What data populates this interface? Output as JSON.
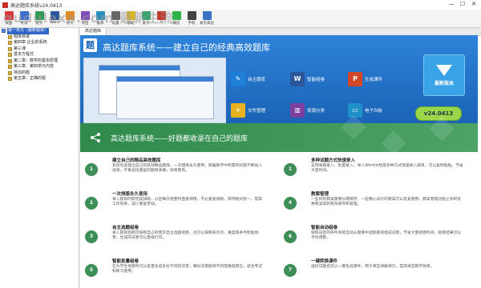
{
  "window": {
    "title": "高达题库系统v24.0413",
    "watermark": "qudulexa.com 最新主流"
  },
  "toolbar": [
    {
      "label": "试卷",
      "icon": "exam-icon",
      "color": "#d83b3b"
    },
    {
      "label": "考试",
      "icon": "test-icon",
      "color": "#3a6fcf"
    },
    {
      "label": "统计",
      "icon": "stats-icon",
      "color": "#2f9a53"
    },
    {
      "label": "Word",
      "icon": "word-icon",
      "color": "#2b579a"
    },
    {
      "label": "导入",
      "icon": "import-icon",
      "color": "#e08a1f"
    },
    {
      "label": "导出",
      "icon": "export-icon",
      "color": "#7d4bb8"
    },
    {
      "label": "备份",
      "icon": "backup-icon",
      "color": "#2a8fbf"
    },
    {
      "label": "设置",
      "icon": "settings-icon",
      "color": "#666666"
    },
    {
      "label": "帮助",
      "icon": "help-icon",
      "color": "#e0b81f"
    },
    {
      "label": "关于",
      "icon": "about-icon",
      "color": "#3aa26a"
    },
    {
      "label": "A",
      "icon": "font-icon",
      "color": "#c0392b"
    },
    {
      "label": "微信",
      "icon": "wechat-icon",
      "color": "#2fb34a"
    },
    {
      "label": "手机",
      "icon": "phone-icon",
      "color": "#444444"
    },
    {
      "label": "关于高达",
      "icon": "info-icon",
      "color": "#3b73c4"
    }
  ],
  "sidebar": [
    {
      "label": "第一单元（最新题目）",
      "root": true,
      "sel": true
    },
    {
      "label": "题库目录",
      "root": false
    },
    {
      "label": "第四章 企业的系统",
      "root": false
    },
    {
      "label": "第三课",
      "root": false
    },
    {
      "label": "基本方程式",
      "root": false
    },
    {
      "label": "第二章：数学的基本原理",
      "root": false
    },
    {
      "label": "第三章：第四单元内容",
      "root": false
    },
    {
      "label": "目前的题",
      "root": false
    },
    {
      "label": "第五章：正确的题",
      "root": false
    }
  ],
  "doc_tab": "高达题库",
  "banner": {
    "logo": "题",
    "title": "高达题库系统——建立自己的经典高效题库",
    "features": [
      {
        "label": "自主题库",
        "icon": "book-icon",
        "color": "#1f7fd6",
        "glyph": "✎"
      },
      {
        "label": "智能组卷",
        "icon": "word-icon",
        "color": "#2b579a",
        "glyph": "W"
      },
      {
        "label": "生成课件",
        "icon": "ppt-icon",
        "color": "#d24726",
        "glyph": "P"
      },
      {
        "label": "文件管理",
        "icon": "folder-icon",
        "color": "#e8b21f",
        "glyph": "+"
      },
      {
        "label": "资源分类",
        "icon": "books-icon",
        "color": "#7b3fa0",
        "glyph": "▥"
      },
      {
        "label": "电子白板",
        "icon": "whiteboard-icon",
        "color": "#1e90c8",
        "glyph": "▭"
      }
    ],
    "download_label": "最新版本",
    "version": "v24.0413"
  },
  "section": {
    "title": "高达题库系统——好题都收录在自己的题库"
  },
  "cards": [
    {
      "num": "1",
      "title": "建立自己的精品高效题库",
      "desc": "系统包含建立自己的高效精品题库，一次建库永久使用，随着教学中积累的好题不断加入进来，不再去找重复的题目来做，效率更高。"
    },
    {
      "num": "1",
      "title": "多种试题方式快速录入",
      "desc": "支持单题录入、批量录入、导入Word文档等多种方式快速录入题目，可以复制粘贴，节省大量时间。"
    },
    {
      "num": "2",
      "title": "一次排版永久使用",
      "desc": "录入题目时即完成排版，以后每次组卷时直接调用，不必重复排版，保持格式统一，提高工作效率，减少重复劳动。"
    },
    {
      "num": "4",
      "title": "教案管理",
      "desc": "一些好的教案需要长期保存，一些精心设计的教案可以反复使用，教案管理功能让你的优秀教案得到有效保存和管理。"
    },
    {
      "num": "3",
      "title": "自主选题组卷",
      "desc": "录入题目后即可按照自己的需求自主选题组卷，也可以按照知识点、难度等条件智能组卷，生成的试卷可以直接打印。"
    },
    {
      "num": "6",
      "title": "智能自动组卷",
      "desc": "按照设定的条件系统自动从题库中选取题目组成试卷，节省大量组卷时间，组卷结果可以手动调整。"
    },
    {
      "num": "5",
      "title": "智能批量组卷",
      "desc": "在为学生组卷时可以批量生成多份不同的试卷，每份试卷题目不同但难度相当，适合考试和练习使用。"
    },
    {
      "num": "7",
      "title": "一键转换课件",
      "desc": "选好试题后可以一键生成课件，用于课堂讲解演示，提高课堂教学效率。"
    }
  ]
}
